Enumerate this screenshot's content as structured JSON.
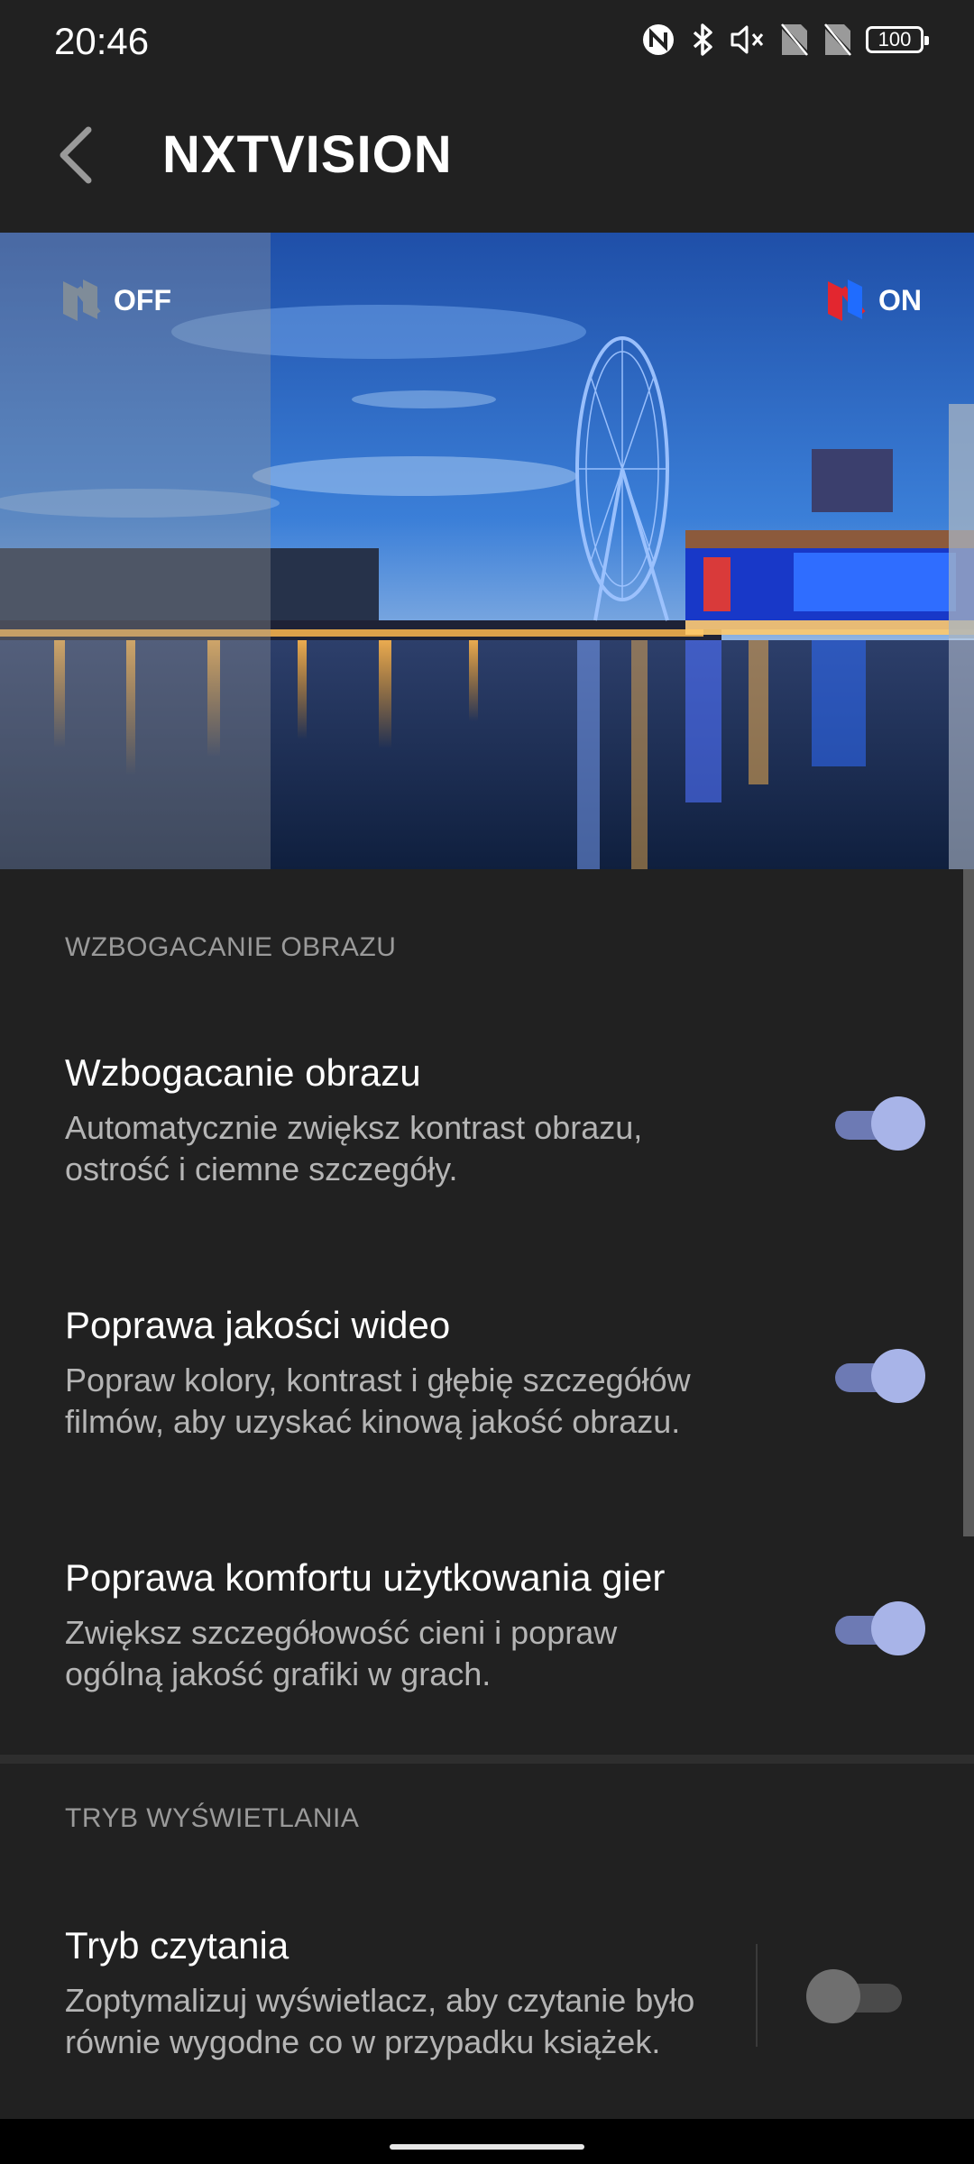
{
  "status": {
    "time": "20:46",
    "battery": "100",
    "icons": [
      "nfc-icon",
      "bluetooth-icon",
      "mute-icon",
      "no-sim-icon",
      "no-sim-icon"
    ]
  },
  "appbar": {
    "title": "NXTVISION"
  },
  "hero": {
    "off_label": "OFF",
    "on_label": "ON"
  },
  "sections": [
    {
      "header": "WZBOGACANIE OBRAZU",
      "items": [
        {
          "title": "Wzbogacanie obrazu",
          "desc_line1": "Automatycznie zwiększ kontrast obrazu,",
          "desc_line2": "ostrość i ciemne szczegóły.",
          "enabled": true
        },
        {
          "title": "Poprawa jakości wideo",
          "desc_line1": "Popraw kolory, kontrast i głębię szczegółów",
          "desc_line2": "filmów, aby uzyskać kinową jakość obrazu.",
          "enabled": true
        },
        {
          "title": "Poprawa komfortu użytkowania gier",
          "desc_line1": "Zwiększ szczegółowość cieni i popraw",
          "desc_line2": "ogólną jakość grafiki w grach.",
          "enabled": true
        }
      ]
    },
    {
      "header": "TRYB WYŚWIETLANIA",
      "items": [
        {
          "title": "Tryb czytania",
          "desc_line1": "Zoptymalizuj wyświetlacz, aby czytanie było",
          "desc_line2": "równie wygodne co w przypadku książek.",
          "enabled": false
        }
      ]
    }
  ],
  "colors": {
    "background": "#212121",
    "toggle_on_track": "#6d7ab4",
    "toggle_on_knob": "#a8b4e8",
    "toggle_off_knob": "#6f6f6f",
    "brand_red": "#e3262f"
  }
}
